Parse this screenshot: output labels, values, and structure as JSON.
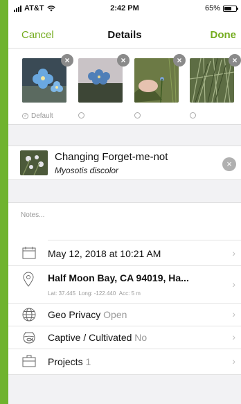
{
  "status": {
    "carrier": "AT&T",
    "time": "2:42 PM",
    "battery": "65%",
    "battery_level": 0.65
  },
  "nav": {
    "cancel": "Cancel",
    "title": "Details",
    "done": "Done"
  },
  "photos": {
    "default_label": "Default",
    "items": [
      {
        "subject": "blue-flower-closeup",
        "close": "×",
        "selected": true
      },
      {
        "subject": "blue-flower-cluster",
        "close": "×",
        "selected": false
      },
      {
        "subject": "hand-holding-plant",
        "close": "×",
        "selected": false
      },
      {
        "subject": "grass-field",
        "close": "×",
        "selected": false
      }
    ]
  },
  "taxon": {
    "common_name": "Changing Forget-me-not",
    "scientific_name": "Myosotis discolor",
    "clear": "×"
  },
  "notes": {
    "placeholder": "Notes..."
  },
  "rows": {
    "date": {
      "label": "May 12, 2018 at 10:21 AM",
      "icon": "calendar-icon"
    },
    "location": {
      "label": "Half Moon Bay, CA  94019, Ha...",
      "lat": "Lat: 37.445",
      "long": "Long: -122.440",
      "acc": "Acc: 5 m",
      "icon": "map-pin-icon"
    },
    "geoprivacy": {
      "label": "Geo Privacy",
      "value": "Open",
      "icon": "globe-icon"
    },
    "captive": {
      "label": "Captive / Cultivated",
      "value": "No",
      "icon": "fishbowl-icon"
    },
    "projects": {
      "label": "Projects",
      "value": "1",
      "icon": "briefcase-icon"
    }
  },
  "chevron": "›",
  "colors": {
    "accent": "#74ac1e",
    "frame": "#6fb32e",
    "muted": "#999999"
  }
}
